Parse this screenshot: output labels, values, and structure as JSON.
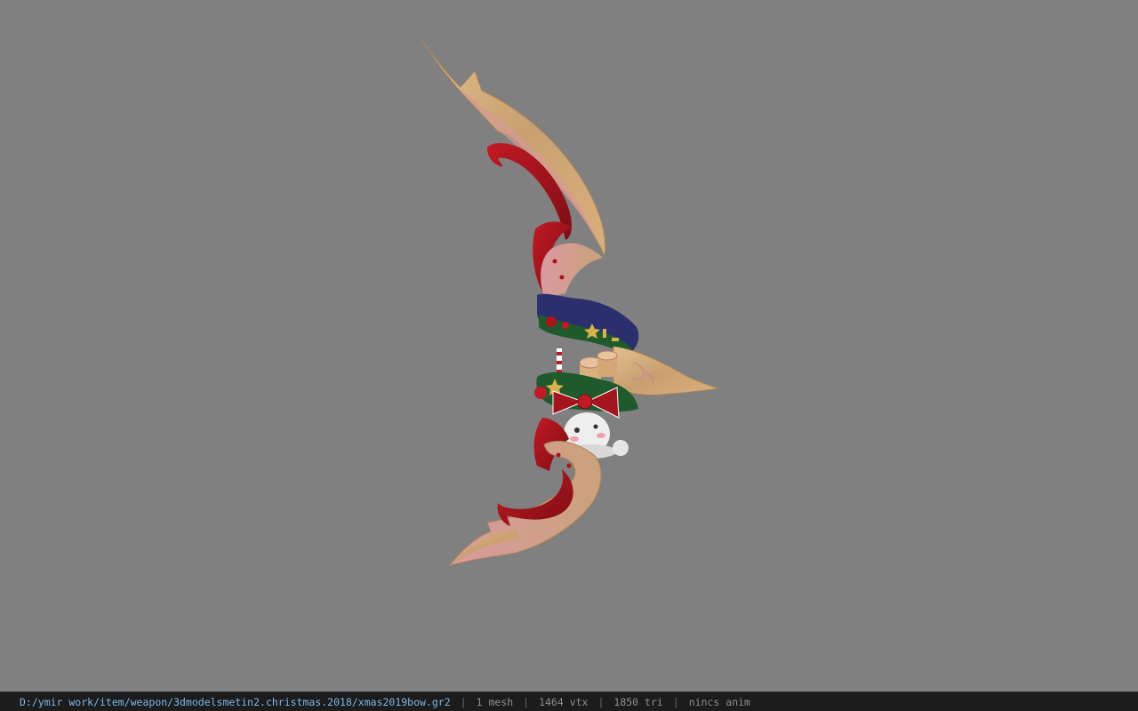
{
  "viewer": {
    "background_color": "#808080",
    "model_icon": "christmas-bow-model"
  },
  "status": {
    "file_path": "D:/ymir work/item/weapon/3dmodelsmetin2.christmas.2018/xmas2019bow.gr2",
    "separator": "|",
    "mesh_count": "1 mesh",
    "vertex_count": "1464 vtx",
    "triangle_count": "1850 tri",
    "anim_status": "nincs anim"
  },
  "colors": {
    "path_text": "#7fb6e6",
    "stat_text": "#8e8e8e",
    "bar_bg": "#1c1c1c",
    "bow_wood": "#d7b07e",
    "bow_red": "#a3141c",
    "holly_green": "#1f5a2c"
  }
}
